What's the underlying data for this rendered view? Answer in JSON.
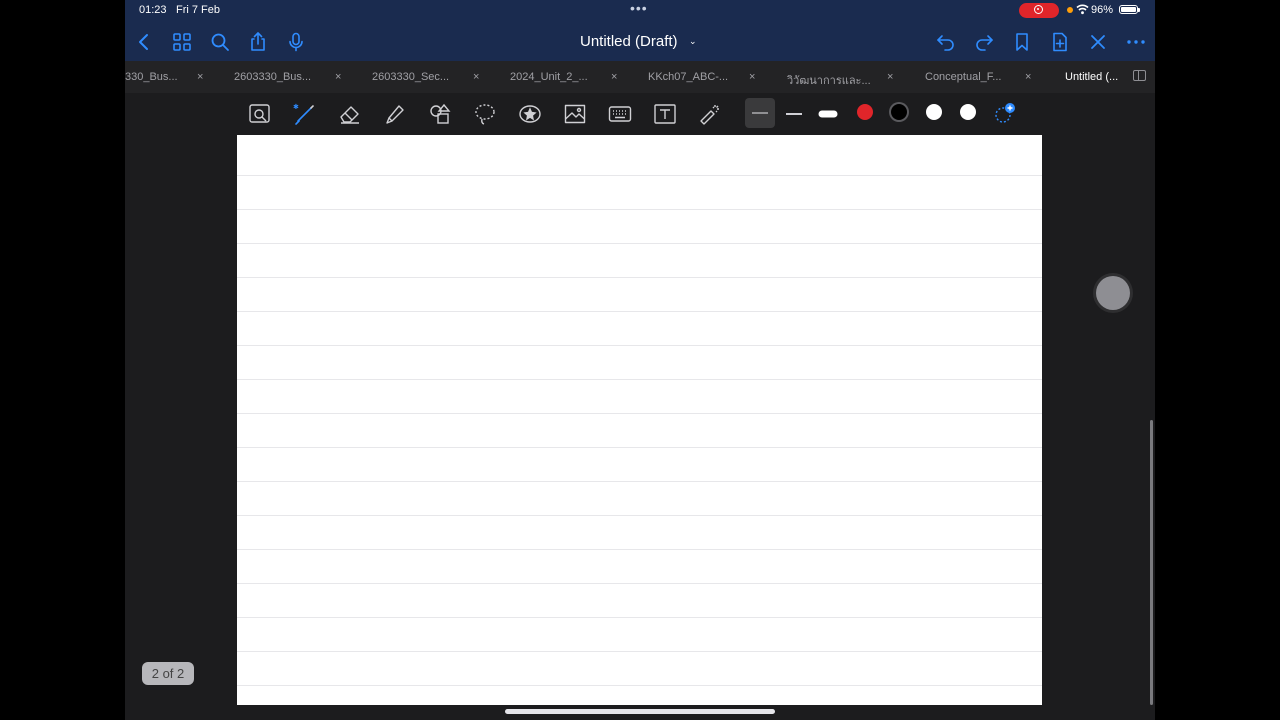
{
  "status": {
    "time": "01:23",
    "date": "Fri 7 Feb",
    "battery": "96%"
  },
  "nav": {
    "title": "Untitled (Draft)",
    "title_chevron": "⌄",
    "icons_left": [
      "back-icon",
      "grid-icon",
      "search-icon",
      "share-icon",
      "microphone-icon"
    ],
    "icons_right": [
      "undo-icon",
      "redo-icon",
      "bookmark-icon",
      "add-page-icon",
      "close-icon",
      "more-icon"
    ],
    "accent": "#2f8cff",
    "more_dots": "•••"
  },
  "tabs": [
    {
      "label": "330_Bus...",
      "close": "×"
    },
    {
      "label": "2603330_Bus...",
      "close": "×"
    },
    {
      "label": "2603330_Sec...",
      "close": "×"
    },
    {
      "label": "2024_Unit_2_...",
      "close": "×"
    },
    {
      "label": "KKch07_ABC-...",
      "close": "×"
    },
    {
      "label": "วิวัฒนาการและ...",
      "close": "×"
    },
    {
      "label": "Conceptual_F...",
      "close": "×"
    },
    {
      "label": "Untitled (...",
      "close": ""
    }
  ],
  "toolbar": {
    "tools": [
      "zoom-window-icon",
      "pen-icon",
      "eraser-icon",
      "highlighter-icon",
      "shapes-icon",
      "lasso-icon",
      "sticker-icon",
      "image-icon",
      "keyboard-icon",
      "text-icon",
      "laser-pointer-icon"
    ],
    "colors": [
      "#e0252a",
      "#000000",
      "#ffffff",
      "#ffffff"
    ]
  },
  "page": {
    "indicator": "2 of 2"
  }
}
